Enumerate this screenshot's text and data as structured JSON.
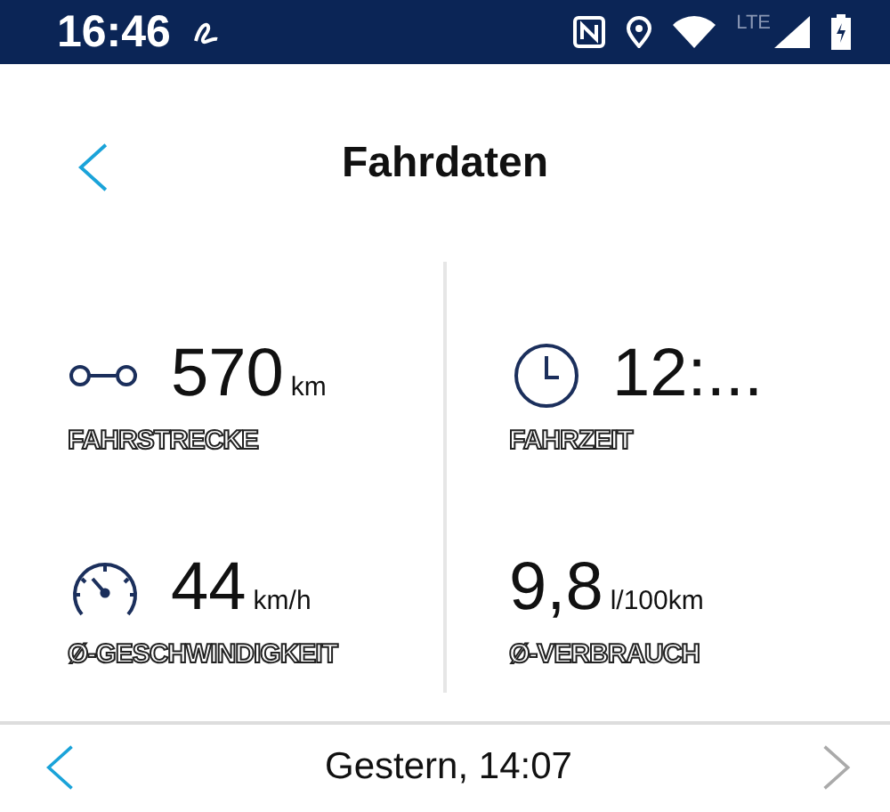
{
  "status_bar": {
    "time": "16:46",
    "network": "LTE"
  },
  "header": {
    "title": "Fahrdaten"
  },
  "metrics": [
    {
      "kind": "distance",
      "value": "570",
      "unit": "km",
      "label": "FAHRSTRECKE"
    },
    {
      "kind": "time",
      "value": "12:...",
      "label": "FAHRZEIT"
    },
    {
      "kind": "speed",
      "value": "44",
      "unit": "km/h",
      "label": "Ø-GESCHWINDIGKEIT"
    },
    {
      "kind": "consumption",
      "value": "9,8",
      "unit": "l/100km",
      "label": "Ø-VERBRAUCH"
    }
  ],
  "footer": {
    "date": "Gestern, 14:07",
    "previous_disabled": false,
    "next_disabled": true
  }
}
